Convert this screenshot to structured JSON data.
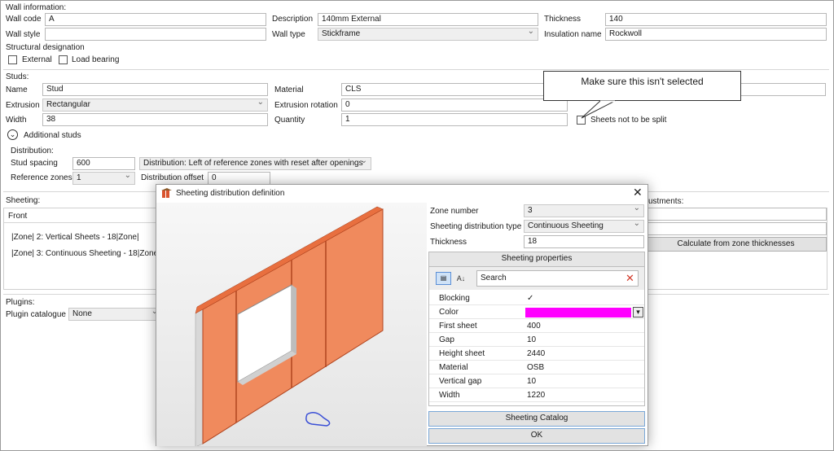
{
  "wall_info": {
    "section_title": "Wall information:",
    "wall_code_label": "Wall code",
    "wall_code_value": "A",
    "description_label": "Description",
    "description_value": "140mm External",
    "thickness_label": "Thickness",
    "thickness_value": "140",
    "wall_style_label": "Wall style",
    "wall_style_value": "",
    "wall_type_label": "Wall type",
    "wall_type_value": "Stickframe",
    "insulation_label": "Insulation name",
    "insulation_value": "Rockwoll",
    "structural_title": "Structural designation",
    "external_label": "External",
    "load_bearing_label": "Load bearing"
  },
  "studs": {
    "section_title": "Studs:",
    "name_label": "Name",
    "name_value": "Stud",
    "material_label": "Material",
    "material_value": "CLS",
    "extrusion_label": "Extrusion",
    "extrusion_value": "Rectangular",
    "extrusion_rotation_label": "Extrusion rotation",
    "extrusion_rotation_value": "0",
    "width_label": "Width",
    "width_value": "38",
    "quantity_label": "Quantity",
    "quantity_value": "1",
    "sheets_not_split_label": "Sheets not to be split",
    "additional_studs_label": "Additional studs"
  },
  "distribution": {
    "title": "Distribution:",
    "stud_spacing_label": "Stud spacing",
    "stud_spacing_value": "600",
    "distribution_value": "Distribution: Left of reference zones with reset after openings",
    "reference_zones_label": "Reference zones",
    "reference_zones_value": "1",
    "distribution_offset_label": "Distribution offset",
    "distribution_offset_value": "0"
  },
  "sheeting": {
    "section_title": "Sheeting:",
    "front_label": "Front",
    "zones": [
      "|Zone| 2: Vertical Sheets - 18|Zone|",
      "|Zone| 3: Continuous Sheeting - 18|Zone|"
    ],
    "adjustments_label": "ustments:",
    "calc_button": "Calculate from zone thicknesses"
  },
  "plugins": {
    "section_title": "Plugins:",
    "catalogue_label": "Plugin catalogue",
    "catalogue_value": "None"
  },
  "callout": {
    "text": "Make sure this isn't selected"
  },
  "dialog": {
    "title": "Sheeting distribution definition",
    "zone_number_label": "Zone number",
    "zone_number_value": "3",
    "dist_type_label": "Sheeting distribution type",
    "dist_type_value": "Continuous Sheeting",
    "thickness_label": "Thickness",
    "thickness_value": "18",
    "props_header": "Sheeting properties",
    "search_placeholder": "Search",
    "properties": [
      {
        "key": "Blocking",
        "value": "✓"
      },
      {
        "key": "Color",
        "value": ""
      },
      {
        "key": "First sheet",
        "value": "400"
      },
      {
        "key": "Gap",
        "value": "10"
      },
      {
        "key": "Height sheet",
        "value": "2440"
      },
      {
        "key": "Material",
        "value": "OSB"
      },
      {
        "key": "Vertical gap",
        "value": "10"
      },
      {
        "key": "Width",
        "value": "1220"
      }
    ],
    "catalog_button": "Sheeting Catalog",
    "ok_button": "OK"
  },
  "colors": {
    "sheet": "#f08a5d",
    "magenta": "#ff00ff",
    "accent": "#2a7ab8"
  }
}
